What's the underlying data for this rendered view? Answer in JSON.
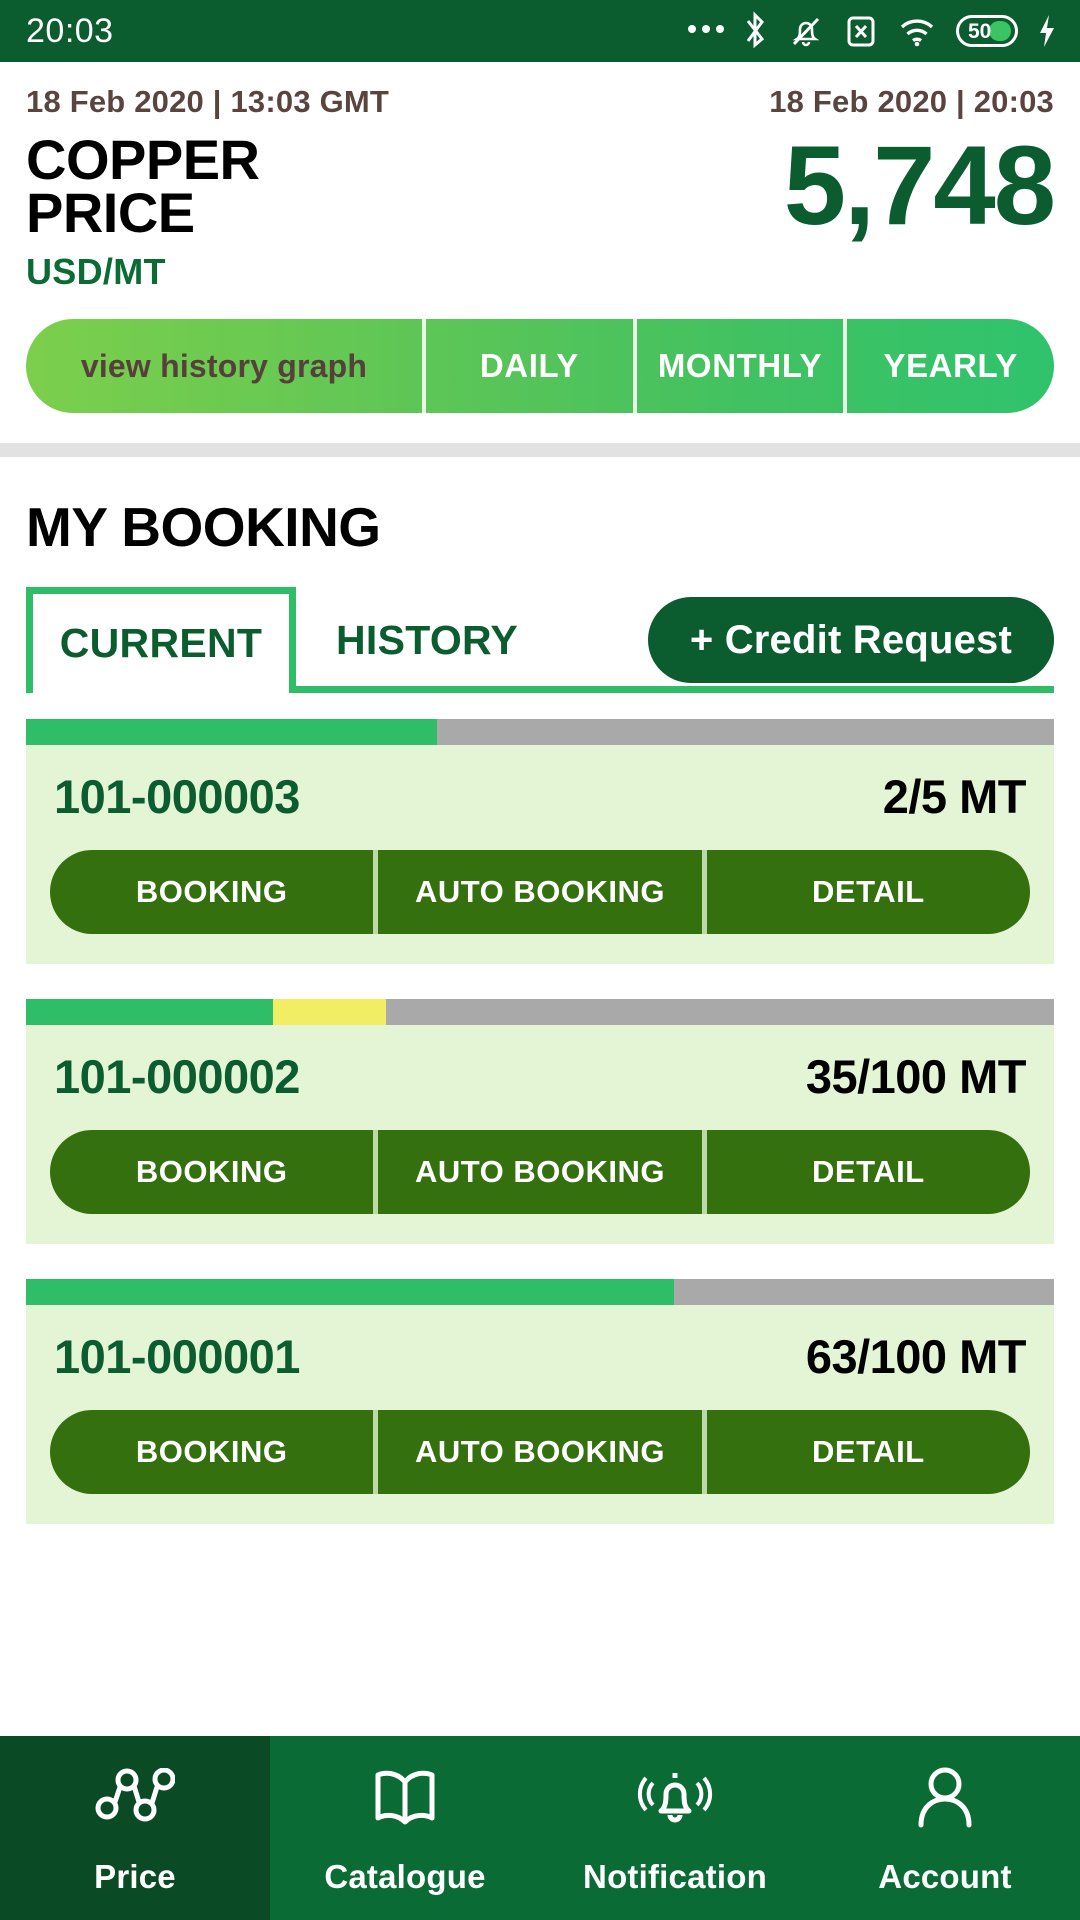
{
  "statusbar": {
    "time": "20:03",
    "battery_percent": "50",
    "icons": [
      "more-dots-icon",
      "bluetooth-icon",
      "mute-bell-icon",
      "sim-x-icon",
      "wifi-icon",
      "battery-icon",
      "charging-bolt-icon"
    ]
  },
  "price_panel": {
    "date_left": "18 Feb 2020 | 13:03 GMT",
    "date_right": "18 Feb 2020 | 20:03",
    "commodity_line1": "COPPER",
    "commodity_line2": "PRICE",
    "unit": "USD/MT",
    "value": "5,748",
    "periods": [
      {
        "label": "view history graph",
        "active": false
      },
      {
        "label": "DAILY",
        "active": false
      },
      {
        "label": "MONTHLY",
        "active": false
      },
      {
        "label": "YEARLY",
        "active": false
      }
    ]
  },
  "booking": {
    "title": "MY BOOKING",
    "tabs": [
      {
        "label": "CURRENT",
        "active": true
      },
      {
        "label": "HISTORY",
        "active": false
      }
    ],
    "credit_request_label": "+ Credit Request",
    "action_labels": {
      "booking": "BOOKING",
      "auto_booking": "AUTO BOOKING",
      "detail": "DETAIL"
    },
    "cards": [
      {
        "id": "101-000003",
        "quantity": "2/5 MT",
        "progress_green_pct": 40,
        "progress_yellow_pct": 0
      },
      {
        "id": "101-000002",
        "quantity": "35/100 MT",
        "progress_green_pct": 24,
        "progress_yellow_pct": 11
      },
      {
        "id": "101-000001",
        "quantity": "63/100 MT",
        "progress_green_pct": 63,
        "progress_yellow_pct": 0
      }
    ]
  },
  "bottom_nav": [
    {
      "label": "Price",
      "icon": "line-chart-icon",
      "active": true
    },
    {
      "label": "Catalogue",
      "icon": "open-book-icon",
      "active": false
    },
    {
      "label": "Notification",
      "icon": "bell-icon",
      "active": false
    },
    {
      "label": "Account",
      "icon": "person-icon",
      "active": false
    }
  ],
  "colors": {
    "brand_dark_green": "#0b5c2e",
    "brand_green": "#0b6b35",
    "accent_green": "#2fbd68",
    "card_bg": "#e4f5d6",
    "action_green": "#34700e",
    "progress_gray": "#a9a9a9",
    "progress_yellow": "#f2ee63",
    "date_text": "#5a4440"
  }
}
